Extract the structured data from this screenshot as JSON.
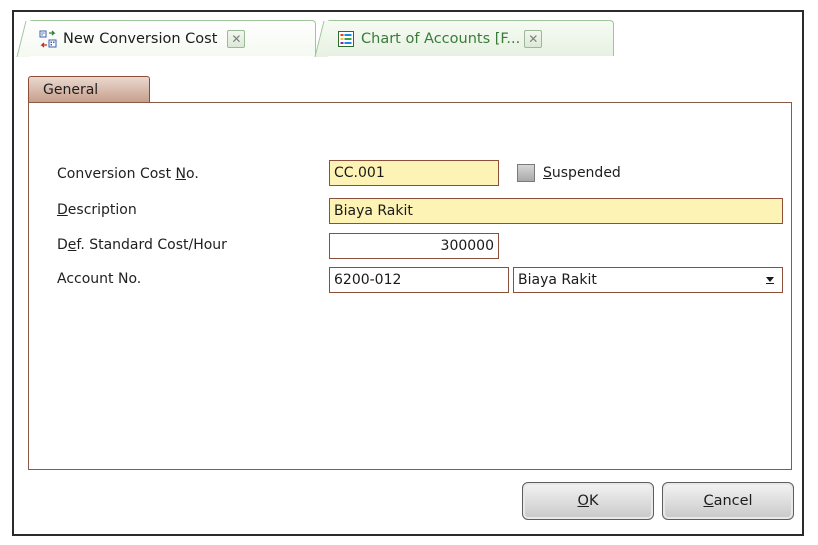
{
  "tabs": [
    {
      "label": "New Conversion Cost",
      "icon": "conversion-cost-icon"
    },
    {
      "label": "Chart of Accounts [F...",
      "icon": "chart-of-accounts-icon"
    }
  ],
  "inner_tab": {
    "label": "General"
  },
  "form": {
    "conversion_cost_no": {
      "label_pre": "Conversion Cost ",
      "label_key": "N",
      "label_post": "o.",
      "value": "CC.001"
    },
    "suspended": {
      "label_key": "S",
      "label_post": "uspended",
      "checked": false
    },
    "description": {
      "label_key": "D",
      "label_post": "escription",
      "value": "Biaya Rakit"
    },
    "standard_cost": {
      "label_pre": "D",
      "label_key": "e",
      "label_post": "f. Standard Cost/Hour",
      "value": "300000"
    },
    "account_no": {
      "label": "Account No.",
      "value": "6200-012",
      "account_name": "Biaya Rakit"
    }
  },
  "buttons": {
    "ok": {
      "label_key": "O",
      "label_post": "K"
    },
    "cancel": {
      "label_key": "C",
      "label_post": "ancel"
    }
  },
  "colors": {
    "field_yellow": "#fdf3b4",
    "field_border": "#8c4f3a",
    "tab_green_border": "#9fc59a",
    "inner_tab_brown": "#c79f8c"
  }
}
